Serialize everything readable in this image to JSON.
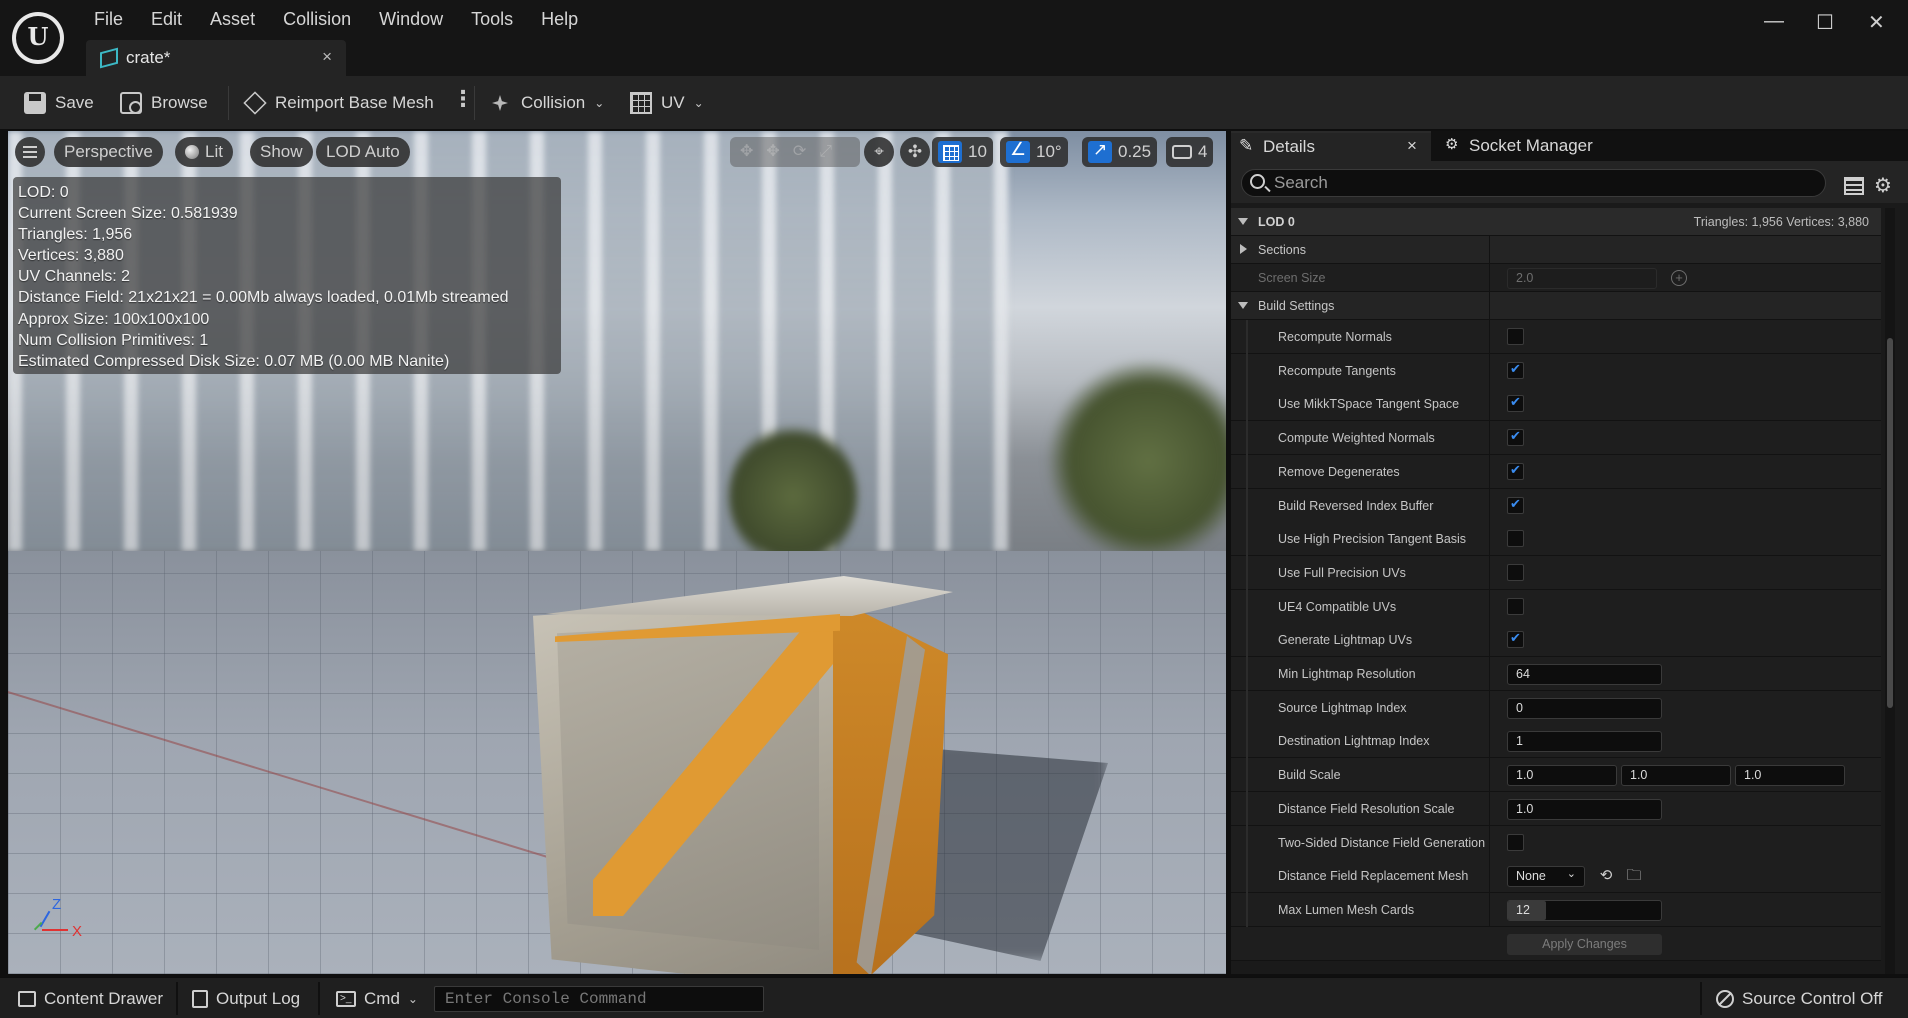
{
  "app": {
    "logo_text": "U",
    "menu": [
      "File",
      "Edit",
      "Asset",
      "Collision",
      "Window",
      "Tools",
      "Help"
    ],
    "doc_tab": {
      "label": "crate*",
      "close": "×"
    },
    "window_controls": {
      "minimize": "—",
      "maximize": "☐",
      "close": "✕"
    }
  },
  "toolbar": {
    "save": "Save",
    "browse": "Browse",
    "reimport": "Reimport Base Mesh",
    "more": "⋮",
    "collision": "Collision",
    "uv": "UV",
    "chevron": "⌄"
  },
  "viewport": {
    "buttons": {
      "perspective": "Perspective",
      "lit": "Lit",
      "show": "Show",
      "lod": "LOD Auto"
    },
    "transform_tools": "✥✥⟳⤢",
    "tool_icons": {
      "surface_snap": "⌖",
      "local_world": "✣"
    },
    "snap": {
      "grid_value": "10",
      "angle_value": "10°",
      "scale_value": "0.25",
      "camera_speed": "4"
    },
    "stats": [
      "LOD: 0",
      "Current Screen Size: 0.581939",
      "Triangles: 1,956",
      "Vertices: 3,880",
      "UV Channels: 2",
      "Distance Field: 21x21x21 = 0.00Mb always loaded, 0.01Mb streamed",
      "Approx Size: 100x100x100",
      "Num Collision Primitives: 1",
      "Estimated Compressed Disk Size: 0.07 MB (0.00 MB Nanite)"
    ],
    "axes": {
      "z": "Z",
      "x": "X"
    }
  },
  "details": {
    "tabs": {
      "details": "Details",
      "details_close": "×",
      "socket_manager": "Socket Manager"
    },
    "search_placeholder": "Search",
    "lod_header": {
      "label": "LOD 0",
      "summary": "Triangles: 1,956    Vertices: 3,880"
    },
    "sections_label": "Sections",
    "screen_size": {
      "label": "Screen Size",
      "value": "2.0"
    },
    "build_settings_label": "Build Settings",
    "props": [
      {
        "label": "Recompute Normals",
        "type": "check",
        "checked": false
      },
      {
        "label": "Recompute Tangents",
        "type": "check",
        "checked": true
      },
      {
        "label": "Use MikkTSpace Tangent Space",
        "type": "check",
        "checked": true
      },
      {
        "label": "Compute Weighted Normals",
        "type": "check",
        "checked": true
      },
      {
        "label": "Remove Degenerates",
        "type": "check",
        "checked": true
      },
      {
        "label": "Build Reversed Index Buffer",
        "type": "check",
        "checked": true
      },
      {
        "label": "Use High Precision Tangent Basis",
        "type": "check",
        "checked": false
      },
      {
        "label": "Use Full Precision UVs",
        "type": "check",
        "checked": false
      },
      {
        "label": "UE4 Compatible UVs",
        "type": "check",
        "checked": false
      },
      {
        "label": "Generate Lightmap UVs",
        "type": "check",
        "checked": true
      },
      {
        "label": "Min Lightmap Resolution",
        "type": "field",
        "value": "64"
      },
      {
        "label": "Source Lightmap Index",
        "type": "field",
        "value": "0"
      },
      {
        "label": "Destination Lightmap Index",
        "type": "field",
        "value": "1"
      },
      {
        "label": "Build Scale",
        "type": "vector",
        "values": [
          "1.0",
          "1.0",
          "1.0"
        ]
      },
      {
        "label": "Distance Field Resolution Scale",
        "type": "field",
        "value": "1.0"
      },
      {
        "label": "Two-Sided Distance Field Generation",
        "type": "check",
        "checked": false
      },
      {
        "label": "Distance Field Replacement Mesh",
        "type": "dropdown",
        "value": "None"
      },
      {
        "label": "Max Lumen Mesh Cards",
        "type": "field",
        "value": "12",
        "fill_fraction": 0.25
      }
    ],
    "apply_button": "Apply Changes",
    "icons": {
      "plus": "+",
      "browse_back": "⟲",
      "folder": "🗀",
      "dropdown": "⌄"
    }
  },
  "statusbar": {
    "content_drawer": "Content Drawer",
    "output_log": "Output Log",
    "cmd": "Cmd",
    "cmd_chevron": "⌄",
    "console_placeholder": "Enter Console Command",
    "source_control": "Source Control Off"
  }
}
